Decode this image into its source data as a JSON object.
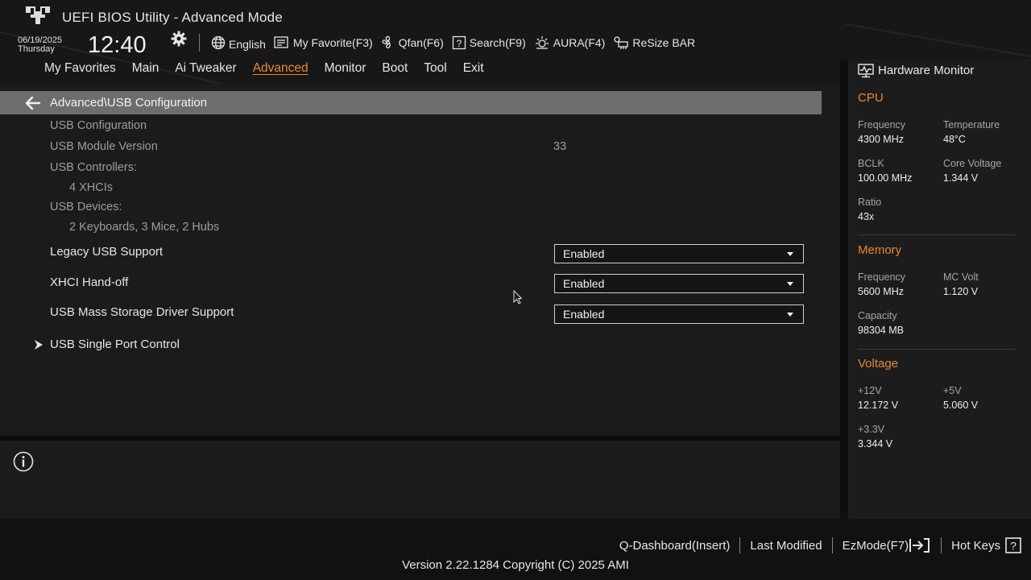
{
  "header": {
    "title": "UEFI BIOS Utility - Advanced Mode",
    "date": "06/19/2025",
    "day": "Thursday",
    "time": "12:40",
    "toolbar": [
      {
        "label": "English",
        "icon": "globe-icon"
      },
      {
        "label": "My Favorite(F3)",
        "icon": "favorite-list-icon"
      },
      {
        "label": "Qfan(F6)",
        "icon": "fan-icon"
      },
      {
        "label": "Search(F9)",
        "icon": "search-question-icon"
      },
      {
        "label": "AURA(F4)",
        "icon": "aura-light-icon"
      },
      {
        "label": "ReSize BAR",
        "icon": "resize-bar-icon"
      }
    ]
  },
  "tabs": [
    {
      "label": "My Favorites",
      "active": false
    },
    {
      "label": "Main",
      "active": false
    },
    {
      "label": "Ai Tweaker",
      "active": false
    },
    {
      "label": "Advanced",
      "active": true
    },
    {
      "label": "Monitor",
      "active": false
    },
    {
      "label": "Boot",
      "active": false
    },
    {
      "label": "Tool",
      "active": false
    },
    {
      "label": "Exit",
      "active": false
    }
  ],
  "breadcrumb": "Advanced\\USB Configuration",
  "main": {
    "usb_config_label": "USB Configuration",
    "module_version_label": "USB Module Version",
    "module_version_value": "33",
    "controllers_label": "USB Controllers:",
    "controllers_value": "4 XHCIs",
    "devices_label": "USB Devices:",
    "devices_value": "2 Keyboards, 3 Mice, 2 Hubs",
    "settings": [
      {
        "label": "Legacy USB Support",
        "value": "Enabled"
      },
      {
        "label": "XHCI Hand-off",
        "value": "Enabled"
      },
      {
        "label": "USB Mass Storage Driver Support",
        "value": "Enabled"
      }
    ],
    "submenu": "USB Single Port Control"
  },
  "hw_monitor": {
    "title": "Hardware Monitor",
    "cpu": {
      "heading": "CPU",
      "frequency_label": "Frequency",
      "frequency_value": "4300 MHz",
      "temperature_label": "Temperature",
      "temperature_value": "48°C",
      "bclk_label": "BCLK",
      "bclk_value": "100.00 MHz",
      "core_voltage_label": "Core Voltage",
      "core_voltage_value": "1.344 V",
      "ratio_label": "Ratio",
      "ratio_value": "43x"
    },
    "memory": {
      "heading": "Memory",
      "frequency_label": "Frequency",
      "frequency_value": "5600 MHz",
      "mc_volt_label": "MC Volt",
      "mc_volt_value": "1.120 V",
      "capacity_label": "Capacity",
      "capacity_value": "98304 MB"
    },
    "voltage": {
      "heading": "Voltage",
      "v12_label": "+12V",
      "v12_value": "12.172 V",
      "v5_label": "+5V",
      "v5_value": "5.060 V",
      "v33_label": "+3.3V",
      "v33_value": "3.344 V"
    }
  },
  "footer": {
    "links": [
      "Q-Dashboard(Insert)",
      "Last Modified",
      "EzMode(F7)",
      "Hot Keys"
    ],
    "version": "Version 2.22.1284 Copyright (C) 2025 AMI"
  },
  "colors": {
    "accent": "#e9892f",
    "background": "#171717",
    "path_bar": "#6d6d6d"
  }
}
